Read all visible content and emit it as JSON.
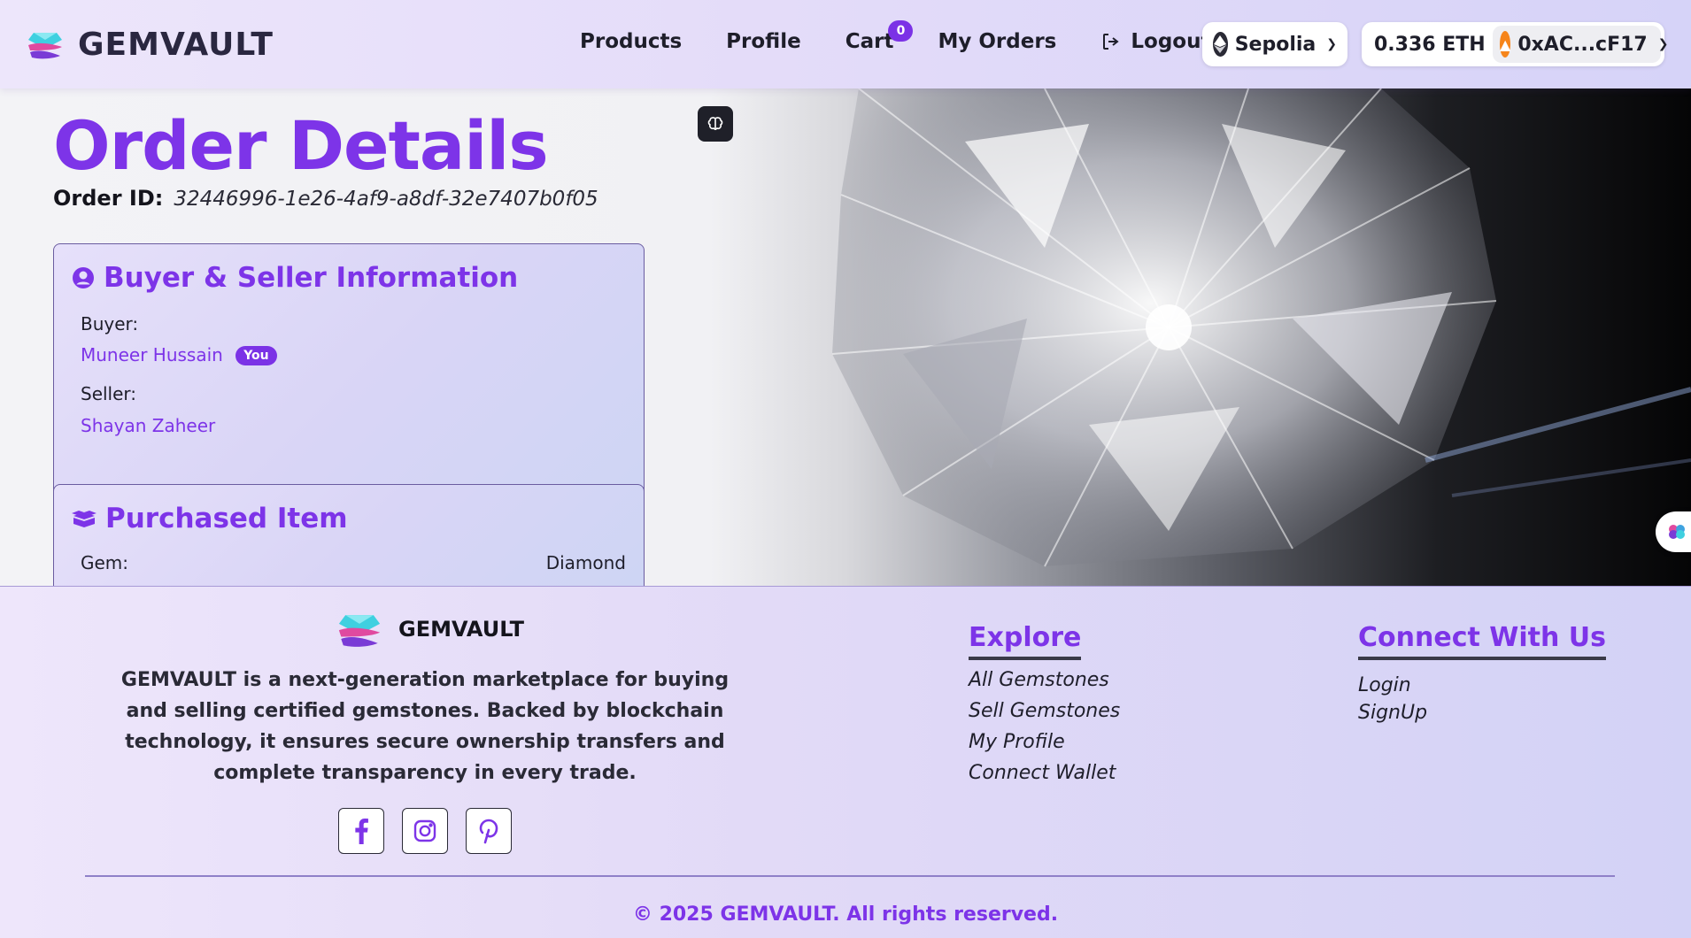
{
  "header": {
    "brand": "GEMVAULT",
    "nav": {
      "products": "Products",
      "profile": "Profile",
      "cart": "Cart",
      "cart_count": "0",
      "my_orders": "My Orders",
      "logout": "Logout"
    },
    "network": "Sepolia",
    "balance": "0.336 ETH",
    "account": "0xAC...cF17"
  },
  "order": {
    "title": "Order Details",
    "id_label": "Order ID:",
    "id_value": "32446996-1e26-4af9-a8df-32e7407b0f05"
  },
  "buyer_seller": {
    "title": "Buyer & Seller Information",
    "buyer_label": "Buyer:",
    "buyer_name": "Muneer Hussain",
    "you_badge": "You",
    "seller_label": "Seller:",
    "seller_name": "Shayan Zaheer"
  },
  "purchased_item": {
    "title": "Purchased Item",
    "gem_label": "Gem:",
    "gem_value": "Diamond"
  },
  "footer": {
    "brand": "GEMVAULT",
    "description": "GEMVAULT is a next-generation marketplace for buying and selling certified gemstones. Backed by blockchain technology, it ensures secure ownership transfers and complete transparency in every trade.",
    "explore": {
      "title": "Explore",
      "links": [
        "All Gemstones",
        "Sell Gemstones",
        "My Profile",
        "Connect Wallet"
      ]
    },
    "connect": {
      "title": "Connect With Us",
      "links": [
        "Login",
        "SignUp"
      ]
    },
    "socials": [
      "facebook-icon",
      "instagram-icon",
      "pinterest-icon"
    ],
    "copyright": "© 2025 GEMVAULT. All rights reserved."
  },
  "colors": {
    "accent": "#7d34e8",
    "badge": "#7b32e6",
    "metamask": "#f6851b"
  }
}
